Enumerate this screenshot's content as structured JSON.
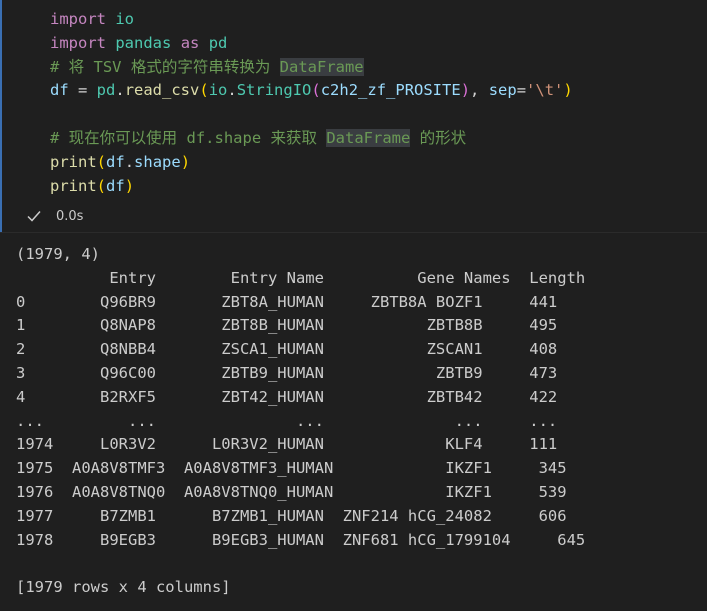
{
  "code_lines": [
    [
      {
        "t": "import",
        "c": "kw"
      },
      {
        "t": " "
      },
      {
        "t": "io",
        "c": "mod"
      }
    ],
    [
      {
        "t": "import",
        "c": "kw"
      },
      {
        "t": " "
      },
      {
        "t": "pandas",
        "c": "mod"
      },
      {
        "t": " "
      },
      {
        "t": "as",
        "c": "kw"
      },
      {
        "t": " "
      },
      {
        "t": "pd",
        "c": "mod"
      }
    ],
    [
      {
        "t": "# 将 TSV 格式的字符串转换为 ",
        "c": "cm"
      },
      {
        "t": "DataFrame",
        "c": "cm hl"
      }
    ],
    [
      {
        "t": "df",
        "c": "var"
      },
      {
        "t": " = "
      },
      {
        "t": "pd",
        "c": "mod"
      },
      {
        "t": "."
      },
      {
        "t": "read_csv",
        "c": "fn"
      },
      {
        "t": "(",
        "c": "paren1"
      },
      {
        "t": "io",
        "c": "mod"
      },
      {
        "t": "."
      },
      {
        "t": "StringIO",
        "c": "mod"
      },
      {
        "t": "(",
        "c": "paren2"
      },
      {
        "t": "c2h2_zf_PROSITE",
        "c": "var"
      },
      {
        "t": ")",
        "c": "paren2"
      },
      {
        "t": ", "
      },
      {
        "t": "sep",
        "c": "var"
      },
      {
        "t": "="
      },
      {
        "t": "'\\t'",
        "c": "str"
      },
      {
        "t": ")",
        "c": "paren1"
      }
    ],
    [],
    [
      {
        "t": "# 现在你可以使用 df.shape 来获取 ",
        "c": "cm"
      },
      {
        "t": "DataFrame",
        "c": "cm hl"
      },
      {
        "t": " 的形状",
        "c": "cm"
      }
    ],
    [
      {
        "t": "print",
        "c": "fn"
      },
      {
        "t": "(",
        "c": "paren1"
      },
      {
        "t": "df",
        "c": "var"
      },
      {
        "t": "."
      },
      {
        "t": "shape",
        "c": "var"
      },
      {
        "t": ")",
        "c": "paren1"
      }
    ],
    [
      {
        "t": "print",
        "c": "fn"
      },
      {
        "t": "(",
        "c": "paren1"
      },
      {
        "t": "df",
        "c": "var"
      },
      {
        "t": ")",
        "c": "paren1"
      }
    ]
  ],
  "status": {
    "icon": "checkmark-icon",
    "duration": "0.0s"
  },
  "output_lines": [
    "(1979, 4)",
    "          Entry        Entry Name          Gene Names  Length",
    "0        Q96BR9       ZBT8A_HUMAN     ZBTB8A BOZF1     441",
    "1        Q8NAP8       ZBT8B_HUMAN           ZBTB8B     495",
    "2        Q8NBB4       ZSCA1_HUMAN           ZSCAN1     408",
    "3        Q96C00       ZBTB9_HUMAN            ZBTB9     473",
    "4        B2RXF5       ZBT42_HUMAN           ZBTB42     422",
    "...         ...               ...              ...     ...",
    "1974     L0R3V2      L0R3V2_HUMAN             KLF4     111",
    "1975  A0A8V8TMF3  A0A8V8TMF3_HUMAN            IKZF1     345",
    "1976  A0A8V8TNQ0  A0A8V8TNQ0_HUMAN            IKZF1     539",
    "1977     B7ZMB1      B7ZMB1_HUMAN  ZNF214 hCG_24082     606",
    "1978     B9EGB3      B9EGB3_HUMAN  ZNF681 hCG_1799104     645",
    "",
    "[1979 rows x 4 columns]"
  ],
  "colors": {
    "background": "#1f1f1f",
    "cell_focus_border": "#3a6fb3",
    "keyword": "#c586c0",
    "module": "#4ec9b0",
    "variable": "#9cdcfe",
    "function": "#dcdcaa",
    "string": "#ce9178",
    "comment": "#6a9955",
    "output_text": "#cccccc"
  }
}
